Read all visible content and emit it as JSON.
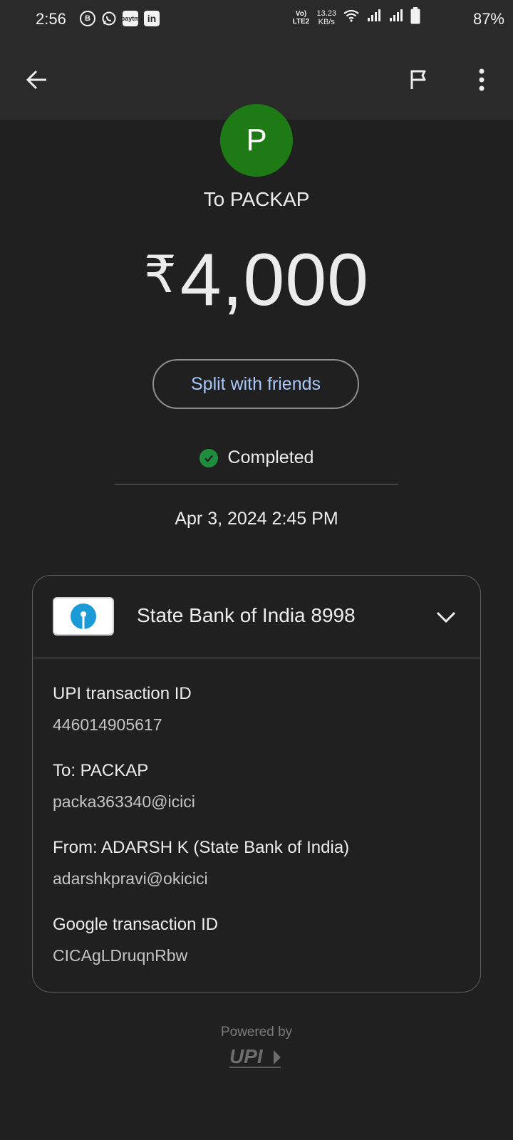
{
  "status_bar": {
    "time": "2:56",
    "network_label": "Vo) LTE2",
    "speed_value": "13.23",
    "speed_unit": "KB/s",
    "battery": "87%",
    "paytm_text": "paytm",
    "linkedin_text": "in",
    "b_text": "B"
  },
  "app_bar": {
    "back_icon": "arrow-back-icon",
    "flag_icon": "flag-icon",
    "menu_icon": "more-vert-icon"
  },
  "payee": {
    "avatar_letter": "P",
    "avatar_color": "#1e7a14",
    "to_label": "To PACKAP"
  },
  "amount": {
    "currency": "₹",
    "value": "4,000"
  },
  "split_button": "Split with friends",
  "transaction_status": {
    "text": "Completed",
    "color": "#1e8e3e"
  },
  "date_time": "Apr 3, 2024 2:45 PM",
  "card": {
    "bank_account": "State Bank of India 8998",
    "details": [
      {
        "label": "UPI transaction ID",
        "value": "446014905617"
      },
      {
        "label": "To: PACKAP",
        "value": "packa363340@icici"
      },
      {
        "label": "From: ADARSH  K (State Bank of India)",
        "value": "adarshkpravi@okicici"
      },
      {
        "label": "Google transaction ID",
        "value": "CICAgLDruqnRbw"
      }
    ]
  },
  "footer": {
    "powered_by": "Powered by",
    "upi_text": "UPI"
  },
  "accent_link_color": "#a8c7fa"
}
